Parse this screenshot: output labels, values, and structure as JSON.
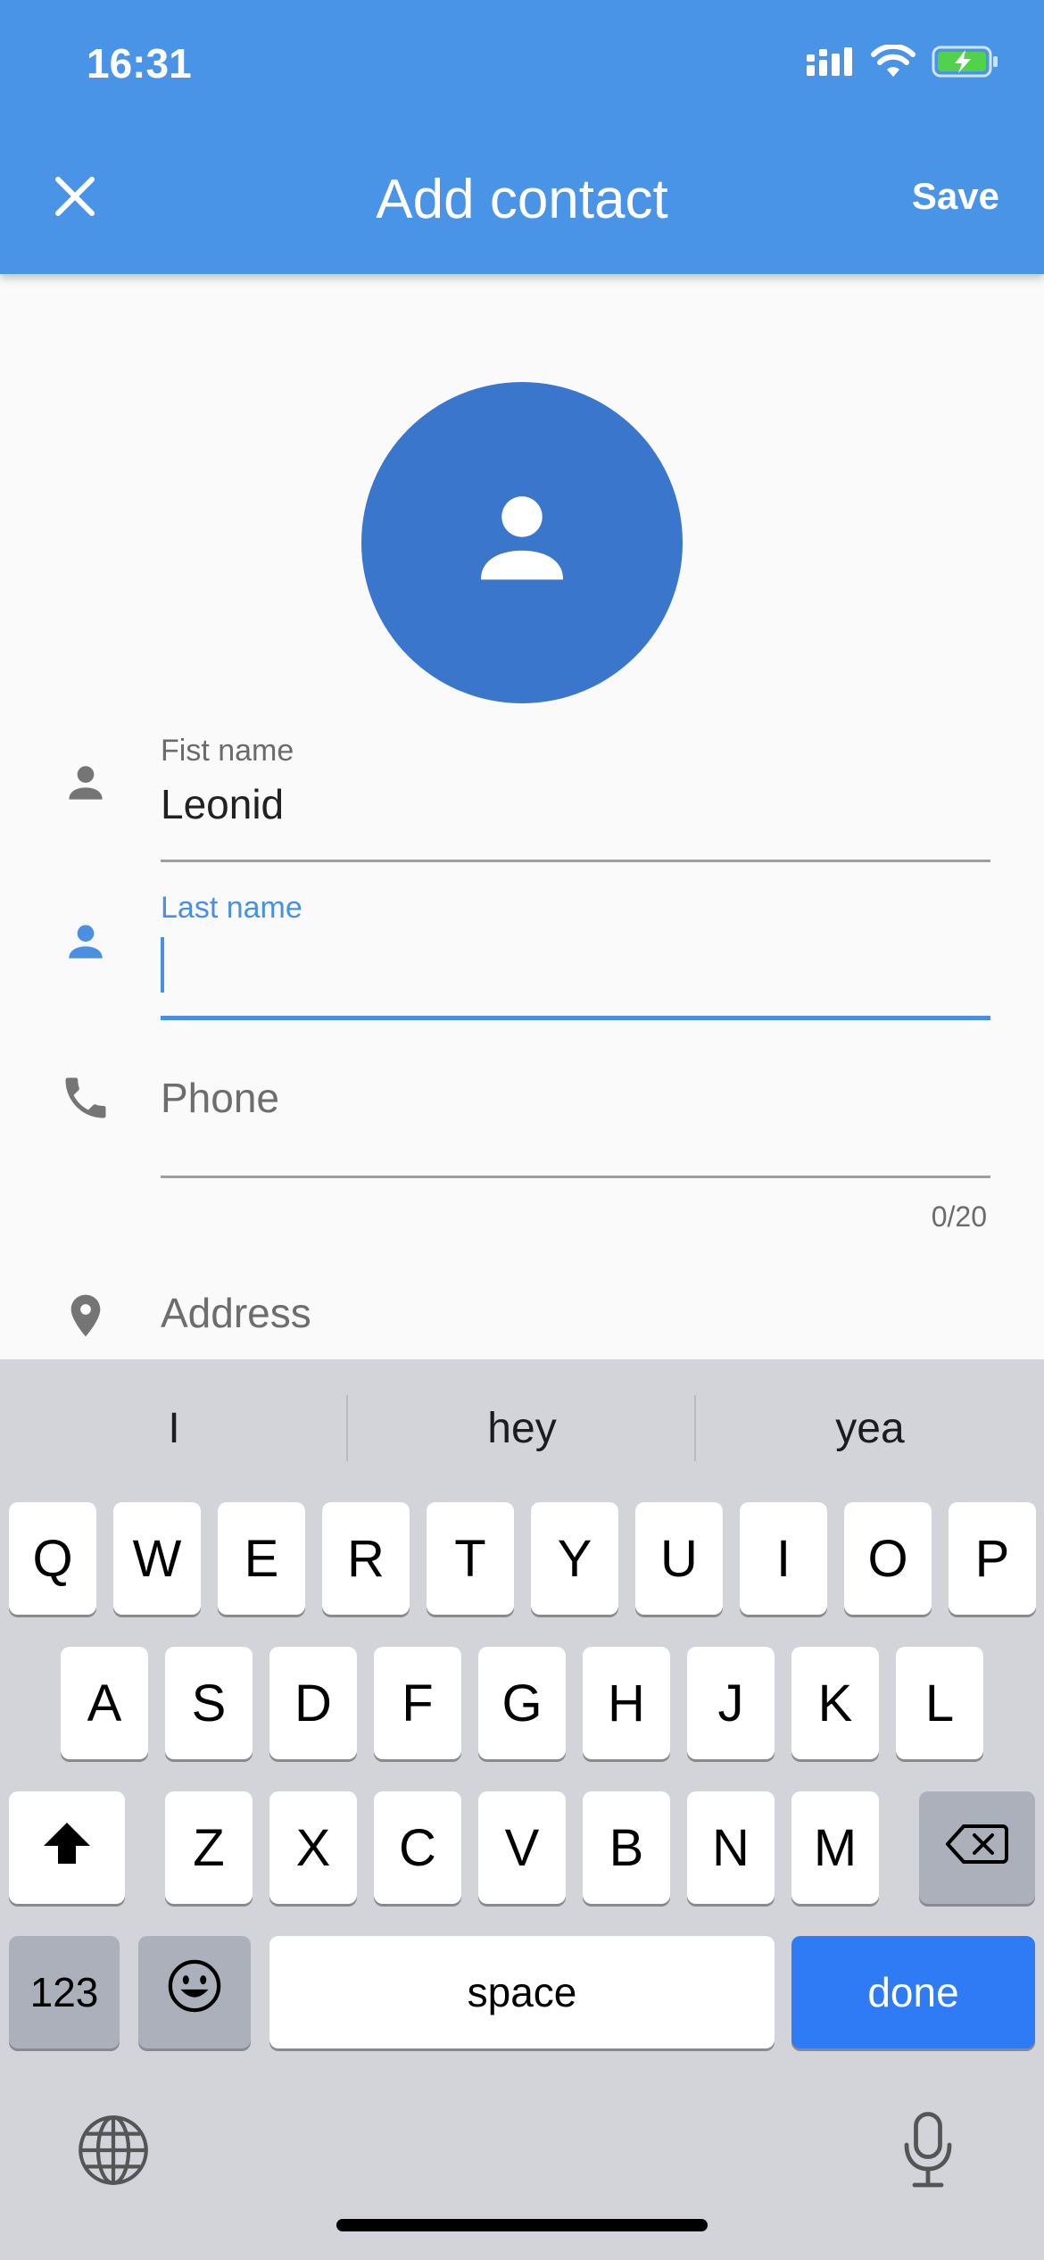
{
  "status_bar": {
    "time": "16:31"
  },
  "header": {
    "title": "Add contact",
    "save_label": "Save"
  },
  "form": {
    "first_name": {
      "label": "Fist name",
      "value": "Leonid"
    },
    "last_name": {
      "label": "Last name",
      "value": ""
    },
    "phone": {
      "placeholder": "Phone",
      "counter": "0/20"
    },
    "address": {
      "placeholder": "Address"
    }
  },
  "colors": {
    "appbar": "#4a94e8",
    "avatar": "#3a76cc",
    "accent": "#4a90e2",
    "done_key": "#2f7bf5"
  },
  "keyboard": {
    "suggestions": [
      "I",
      "hey",
      "yea"
    ],
    "row1": [
      "Q",
      "W",
      "E",
      "R",
      "T",
      "Y",
      "U",
      "I",
      "O",
      "P"
    ],
    "row2": [
      "A",
      "S",
      "D",
      "F",
      "G",
      "H",
      "J",
      "K",
      "L"
    ],
    "row3": [
      "Z",
      "X",
      "C",
      "V",
      "B",
      "N",
      "M"
    ],
    "numbers_label": "123",
    "space_label": "space",
    "done_label": "done"
  },
  "icons": [
    "signal-icon",
    "wifi-icon",
    "battery-charging-icon",
    "close-icon",
    "person-icon",
    "phone-icon",
    "location-pin-icon",
    "shift-icon",
    "backspace-icon",
    "emoji-icon",
    "globe-icon",
    "microphone-icon"
  ]
}
